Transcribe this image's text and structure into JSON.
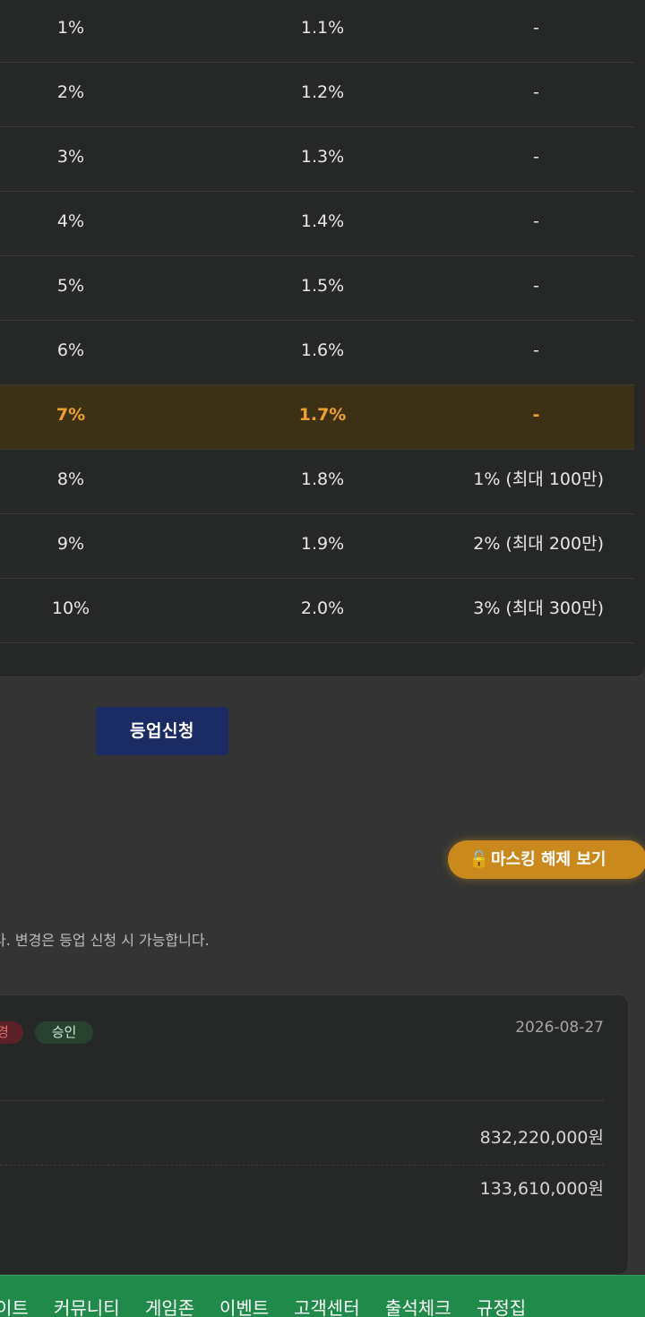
{
  "table": {
    "rows": [
      {
        "col1": "1%",
        "col2": "1.1%",
        "col3": "-",
        "highlight": false
      },
      {
        "col1": "2%",
        "col2": "1.2%",
        "col3": "-",
        "highlight": false
      },
      {
        "col1": "3%",
        "col2": "1.3%",
        "col3": "-",
        "highlight": false
      },
      {
        "col1": "4%",
        "col2": "1.4%",
        "col3": "-",
        "highlight": false
      },
      {
        "col1": "5%",
        "col2": "1.5%",
        "col3": "-",
        "highlight": false
      },
      {
        "col1": "6%",
        "col2": "1.6%",
        "col3": "-",
        "highlight": false
      },
      {
        "col1": "7%",
        "col2": "1.7%",
        "col3": "-",
        "highlight": true
      },
      {
        "col1": "8%",
        "col2": "1.8%",
        "col3": "1% (최대 100만)",
        "highlight": false
      },
      {
        "col1": "9%",
        "col2": "1.9%",
        "col3": "2% (최대 200만)",
        "highlight": false
      },
      {
        "col1": "10%",
        "col2": "2.0%",
        "col3": "3% (최대 300만)",
        "highlight": false
      }
    ],
    "highlight_color": "#efa033"
  },
  "actions": {
    "upgrade_label": "등업신청",
    "unmask_label": "마스킹 해제 보기",
    "unmask_icon": "unlock-icon"
  },
  "notice": {
    "text": "다. 변경은 등업 신청 시 가능합니다."
  },
  "info": {
    "badge_partial": "경",
    "badge_status": "승인",
    "date": "2026-08-27",
    "amount1": "832,220,000원",
    "amount2": "133,610,000원"
  },
  "bottom_nav": {
    "items": [
      "이트",
      "커뮤니티",
      "게임존",
      "이벤트",
      "고객센터",
      "출석체크",
      "규정집"
    ]
  },
  "colors": {
    "background": "#333433",
    "card": "#262727",
    "upgrade_button": "#1b2b63",
    "unmask_button": "#c9891d",
    "nav": "#1f8a49"
  }
}
